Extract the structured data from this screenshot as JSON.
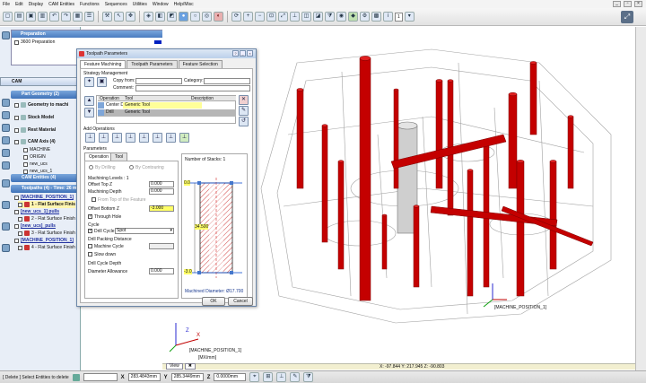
{
  "menu": [
    "File",
    "Edit",
    "Display",
    "CAM Entities",
    "Functions",
    "Sequences",
    "Utilities",
    "Window",
    "Help/Misc"
  ],
  "toolbar": {
    "page_value": "1"
  },
  "preparation": {
    "title": "Preparation",
    "item": "3600 Preparation"
  },
  "cam_tab": "CAM",
  "tree": {
    "part_geometry": "Part Geometry (2)",
    "geometry_to_machine": "Geometry to machi",
    "stock_model": "Stock Model",
    "rest_material": "Rest Material",
    "cam_axis": "CAM Axis (4)",
    "axes": [
      "MACHINE",
      "ORIGIN",
      "new_ucs",
      "new_ucs_1"
    ],
    "cam_entities": "CAM Entities (4)",
    "toolpaths": "Toolpaths (4) - Time: 26 mi",
    "tp_rows": [
      "[MACHINE_POSITION_1]",
      "1 - Flat Surface Finis",
      "[new_ucs_1] pulls",
      "2 - Flat Surface Finish",
      "[new_ucs]_pulls",
      "3 - Flat Surface Finish",
      "[MACHINE_POSITION_1]",
      "4 - Flat Surface Finish"
    ]
  },
  "dialog": {
    "title": "Toolpath Parameters",
    "tabs": [
      "Feature Machining",
      "Toolpath Parameters",
      "Feature Selection"
    ],
    "strategy_management": "Strategy Management",
    "copy_from_label": "Copy from:",
    "category_label": "Category:",
    "comment_label": "Comment:",
    "grid_headers": [
      "Operation",
      "Tool",
      "Description"
    ],
    "grid_rows": [
      {
        "op": "Center Drill",
        "tool": "Generic Tool"
      },
      {
        "op": "Drill",
        "tool": "Generic Tool"
      }
    ],
    "add_operations": "Add Operations",
    "parameters": "Parameters",
    "param_tabs": [
      "Operation",
      "Tool"
    ],
    "by_drilling": "By Drilling",
    "by_contouring": "By Contouring",
    "machining_levels": "Machining Levels : 1",
    "offset_top_z": "Offset Top Z",
    "offset_top_z_val": "0.000",
    "machining_depth": "Machining Depth",
    "machining_depth_val": "0.000",
    "from_top": "From Top of the Feature",
    "offset_bottom_z": "Offset Bottom Z",
    "offset_bottom_z_val": "-3.000",
    "through_hole": "Through Hole",
    "cycle": "Cycle",
    "drill_cycle": "Drill Cycle",
    "drill_cycle_val": "Spot",
    "drill_packing": "Drill Packing Distance",
    "machine_cycle": "Machine Cycle",
    "slow_down": "Slow down",
    "drill_cycle_depth": "Drill Cycle Depth",
    "diameter_allowance": "Diameter Allowance",
    "diameter_allowance_val": "0.000",
    "stacks": "Number of Stacks: 1",
    "dim_top": "0.0",
    "dim_mid": "34.500",
    "dim_bottom": "-3.0",
    "machined_diameter": "Machined Diameter: Ø17.700",
    "ok": "OK",
    "cancel": "Cancel"
  },
  "viewport": {
    "machine_label_right": "[MACHINE_POSITION_1]",
    "machine_label_left": "[MACHINE_POSITION_1]",
    "axis_sub": "[MX/mm]",
    "coords_info": "X: -97.844   Y: 217.945   Z: -90.803",
    "view_tabs": [
      "View",
      "✖"
    ]
  },
  "status": {
    "select_text": "[ Delete ] Select Entities to delete",
    "x_val": "283.4843mm",
    "y_val": "285.3449mm",
    "z_val": "0.0000mm"
  },
  "colors": {
    "accent": "#4a7cc0",
    "highlight": "#fff6b0",
    "red": "#c40000"
  }
}
